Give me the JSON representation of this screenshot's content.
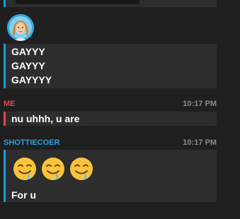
{
  "messages": {
    "first": {
      "lines": [
        "GAYYY",
        "GAYYY",
        "GAYYYY"
      ]
    },
    "me": {
      "author": "ME",
      "time": "10:17 PM",
      "text": "nu uhhh, u are"
    },
    "shottiecoer": {
      "author": "SHOTTIECOER",
      "time": "10:17 PM",
      "emojis": [
        "drooling-face",
        "drooling-face",
        "drooling-face"
      ],
      "text": "For u"
    }
  },
  "colors": {
    "background": "#1f1f1f",
    "bubble": "#2d2d2d",
    "accent_blue": "#1a9bd7",
    "accent_red": "#e2454f",
    "time": "#8c8c8c"
  }
}
